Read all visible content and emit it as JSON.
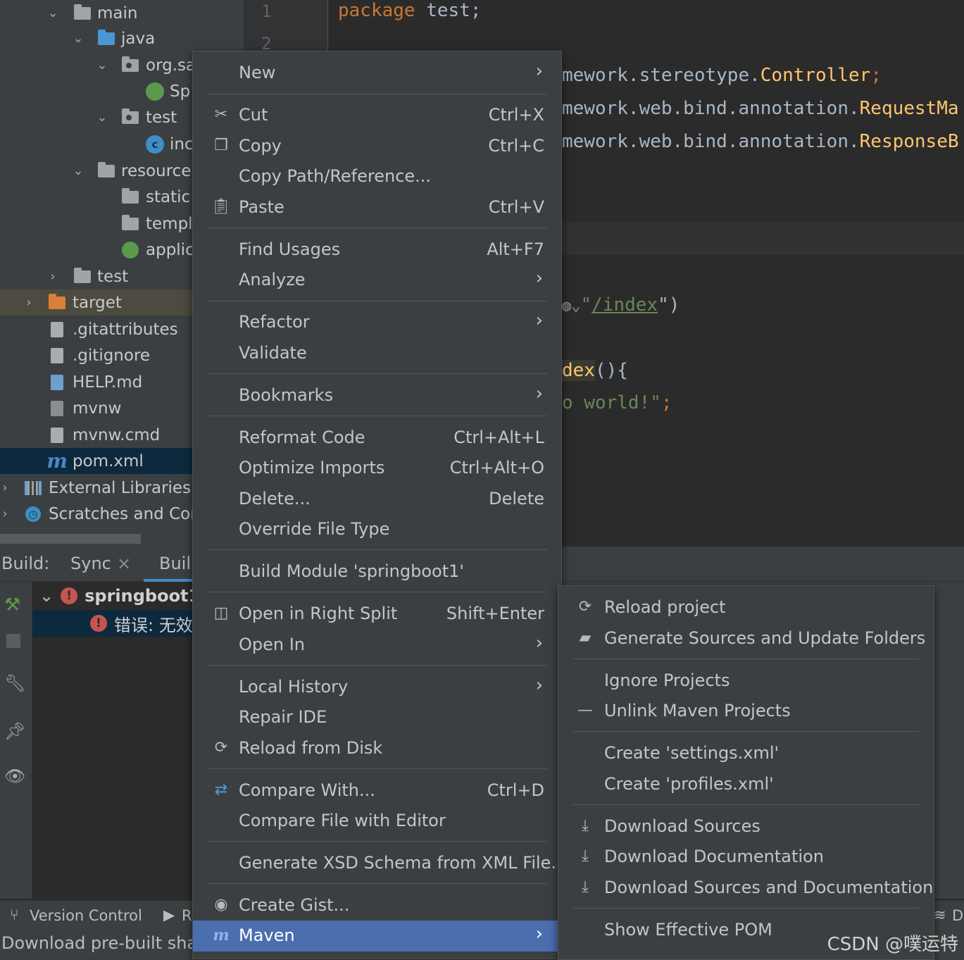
{
  "project_tree": [
    {
      "label": "main",
      "icon": "folder-icon"
    },
    {
      "label": "java",
      "icon": "source-folder-icon"
    },
    {
      "label": "org.sa",
      "icon": "package-icon"
    },
    {
      "label": "Sp",
      "icon": "spring-app-icon"
    },
    {
      "label": "test",
      "icon": "package-icon"
    },
    {
      "label": "inc",
      "icon": "class-icon"
    },
    {
      "label": "resource",
      "icon": "resources-folder-icon"
    },
    {
      "label": "static",
      "icon": "folder-icon"
    },
    {
      "label": "templ",
      "icon": "folder-icon"
    },
    {
      "label": "applic",
      "icon": "spring-config-icon"
    },
    {
      "label": "test",
      "icon": "folder-icon"
    },
    {
      "label": "target",
      "icon": "excluded-folder-icon"
    },
    {
      "label": ".gitattributes",
      "icon": "file-icon"
    },
    {
      "label": ".gitignore",
      "icon": "gitignore-file-icon"
    },
    {
      "label": "HELP.md",
      "icon": "markdown-file-icon"
    },
    {
      "label": "mvnw",
      "icon": "shell-file-icon"
    },
    {
      "label": "mvnw.cmd",
      "icon": "file-icon"
    },
    {
      "label": "pom.xml",
      "icon": "maven-icon"
    },
    {
      "label": "External Libraries",
      "icon": "libraries-icon"
    },
    {
      "label": "Scratches and Cor",
      "icon": "scratches-icon"
    }
  ],
  "editor": {
    "line_numbers": [
      "1",
      "2"
    ],
    "line1_keyword": "package",
    "line1_rest": " test;",
    "import1_pkg": "mework.stereotype.",
    "import1_cls": "Controller",
    "import2_pkg": "mework.web.bind.annotation.",
    "import2_cls": "RequestMa",
    "import3_pkg": "mework.web.bind.annotation.",
    "import3_cls": "ResponseB",
    "mapping_open": "\"",
    "mapping_path": "/index",
    "mapping_close": "\")",
    "method_name": "dex",
    "method_rest": "(){",
    "return_str": "o world!\"",
    "return_end": ";"
  },
  "build_panel": {
    "label": "Build:",
    "tab_sync": "Sync",
    "tab_build": "Buil",
    "project_name": "springboot1",
    "error_text": "错误: 无效"
  },
  "status_bar": {
    "version_control": "Version Control",
    "run_tab": "R",
    "message": "Download pre-built shar",
    "right_label": "D"
  },
  "context_menu": [
    {
      "label": "New",
      "submenu": true
    },
    {
      "label": "Cut",
      "shortcut": "Ctrl+X",
      "icon": "scissors-icon"
    },
    {
      "label": "Copy",
      "shortcut": "Ctrl+C",
      "icon": "copy-icon"
    },
    {
      "label": "Copy Path/Reference..."
    },
    {
      "label": "Paste",
      "shortcut": "Ctrl+V",
      "icon": "paste-icon"
    },
    {
      "label": "Find Usages",
      "shortcut": "Alt+F7"
    },
    {
      "label": "Analyze",
      "submenu": true
    },
    {
      "label": "Refactor",
      "submenu": true
    },
    {
      "label": "Validate"
    },
    {
      "label": "Bookmarks",
      "submenu": true
    },
    {
      "label": "Reformat Code",
      "shortcut": "Ctrl+Alt+L"
    },
    {
      "label": "Optimize Imports",
      "shortcut": "Ctrl+Alt+O"
    },
    {
      "label": "Delete...",
      "shortcut": "Delete"
    },
    {
      "label": "Override File Type"
    },
    {
      "label": "Build Module 'springboot1'"
    },
    {
      "label": "Open in Right Split",
      "shortcut": "Shift+Enter",
      "icon": "split-icon"
    },
    {
      "label": "Open In",
      "submenu": true
    },
    {
      "label": "Local History",
      "submenu": true
    },
    {
      "label": "Repair IDE"
    },
    {
      "label": "Reload from Disk",
      "icon": "reload-icon"
    },
    {
      "label": "Compare With...",
      "shortcut": "Ctrl+D",
      "icon": "compare-icon"
    },
    {
      "label": "Compare File with Editor"
    },
    {
      "label": "Generate XSD Schema from XML File..."
    },
    {
      "label": "Create Gist...",
      "icon": "github-icon"
    },
    {
      "label": "Maven",
      "submenu": true,
      "active": true,
      "icon": "maven-icon"
    }
  ],
  "maven_submenu": [
    {
      "label": "Reload project",
      "icon": "reload-icon"
    },
    {
      "label": "Generate Sources and Update Folders",
      "icon": "generate-sources-icon"
    },
    {
      "label": "Ignore Projects"
    },
    {
      "label": "Unlink Maven Projects",
      "icon": "minus-icon"
    },
    {
      "label": "Create 'settings.xml'"
    },
    {
      "label": "Create 'profiles.xml'"
    },
    {
      "label": "Download Sources",
      "icon": "download-icon"
    },
    {
      "label": "Download Documentation",
      "icon": "download-icon"
    },
    {
      "label": "Download Sources and Documentation",
      "icon": "download-icon"
    },
    {
      "label": "Show Effective POM"
    }
  ],
  "watermark": "CSDN @噗运特",
  "colors": {
    "menu_bg": "#3c3f41",
    "active_item": "#4b6eaf",
    "keyword": "#cc7832",
    "class_name": "#ffc66d",
    "string": "#6a8759",
    "error": "#c75450"
  }
}
